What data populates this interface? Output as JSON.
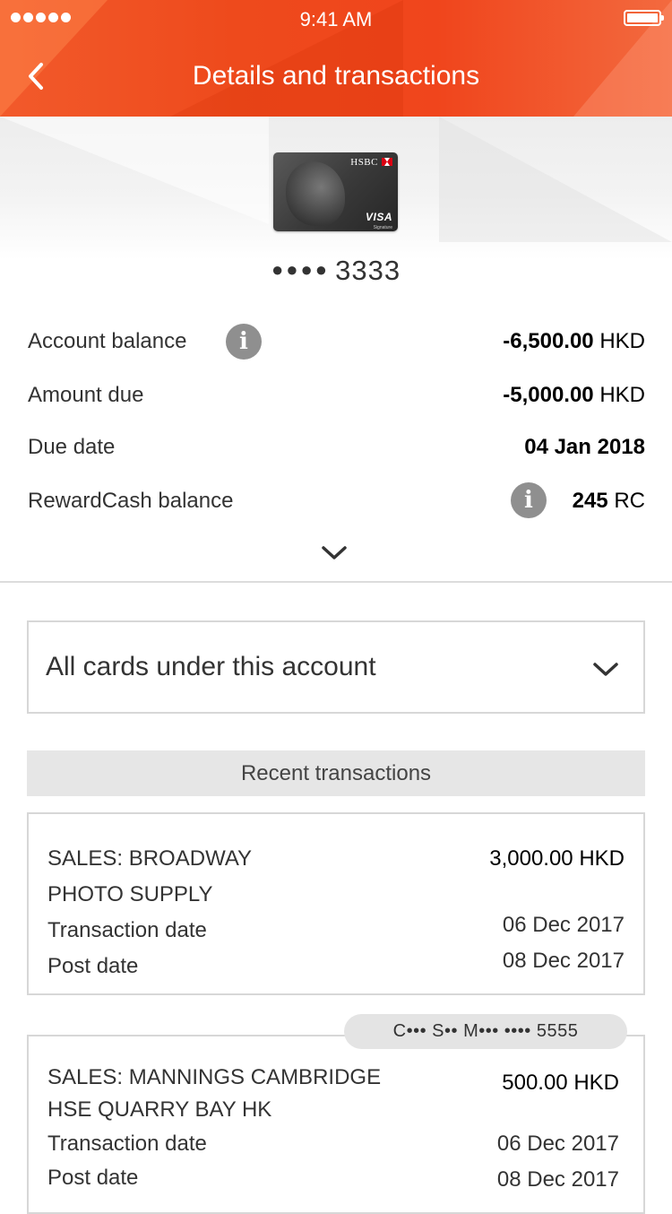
{
  "status_bar": {
    "time": "9:41 AM"
  },
  "header": {
    "title": "Details and transactions"
  },
  "card": {
    "brand": "HSBC",
    "network": "VISA",
    "tier": "Signature",
    "masked_dots": "●●●●",
    "last_digits": "3333"
  },
  "summary": {
    "account_balance": {
      "label": "Account balance",
      "amount": "-6,500.00",
      "currency": "HKD"
    },
    "amount_due": {
      "label": "Amount due",
      "amount": "-5,000.00",
      "currency": "HKD"
    },
    "due_date": {
      "label": "Due date",
      "value": "04 Jan 2018"
    },
    "rewardcash": {
      "label": "RewardCash balance",
      "amount": "245",
      "unit": "RC"
    }
  },
  "card_filter": {
    "selected": "All cards under this account"
  },
  "recent_transactions": {
    "title": "Recent transactions",
    "items": [
      {
        "description_line1": "SALES: BROADWAY",
        "description_line2": "PHOTO SUPPLY",
        "amount": "3,000.00 HKD",
        "transaction_date_label": "Transaction date",
        "transaction_date": "06 Dec 2017",
        "post_date_label": "Post date",
        "post_date": "08 Dec 2017"
      },
      {
        "card_badge": "C••• S•• M•••   •••• 5555",
        "description_line1": "SALES: MANNINGS CAMBRIDGE",
        "description_line2": "HSE QUARRY BAY HK",
        "amount": "500.00 HKD",
        "transaction_date_label": "Transaction date",
        "transaction_date": "06 Dec 2017",
        "post_date_label": "Post date",
        "post_date": "08 Dec 2017"
      }
    ]
  },
  "colors": {
    "header_orange": "#ee4a1c",
    "info_grey": "#8f8f8f",
    "border_grey": "#d7d7d7",
    "hsbc_red": "#db0011"
  },
  "icons": [
    "back-chevron-icon",
    "info-icon",
    "chevron-down-icon",
    "signal-icon",
    "battery-icon"
  ]
}
